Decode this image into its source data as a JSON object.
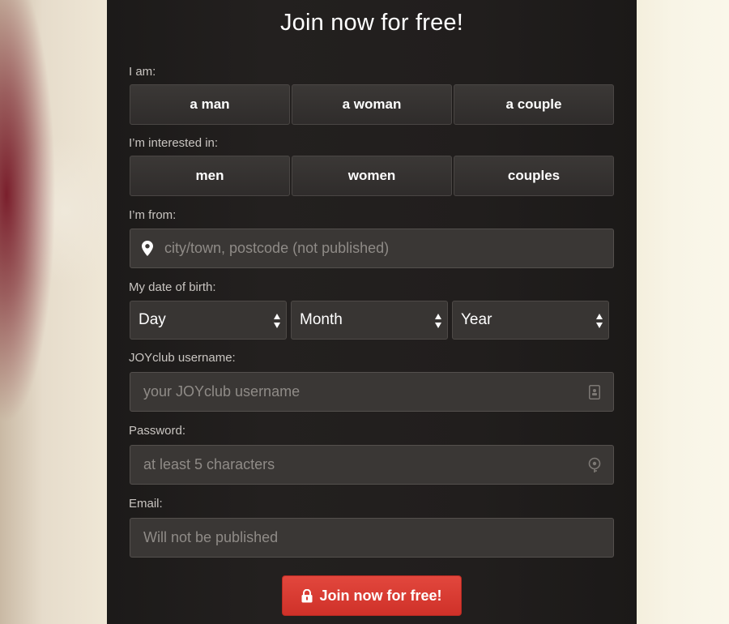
{
  "form": {
    "title": "Join now for free!",
    "gender": {
      "label": "I am:",
      "options": [
        "a man",
        "a woman",
        "a couple"
      ]
    },
    "interest": {
      "label": "I’m interested in:",
      "options": [
        "men",
        "women",
        "couples"
      ]
    },
    "location": {
      "label": "I’m from:",
      "placeholder": "city/town, postcode (not published)",
      "icon": "location-pin-icon"
    },
    "birth": {
      "label": "My date of birth:",
      "day": "Day",
      "month": "Month",
      "year": "Year"
    },
    "username": {
      "label": "JOYclub username:",
      "placeholder": "your JOYclub username",
      "icon": "contact-card-icon"
    },
    "password": {
      "label": "Password:",
      "placeholder": "at least 5 characters",
      "icon": "password-key-icon"
    },
    "email": {
      "label": "Email:",
      "placeholder": "Will not be published"
    },
    "submit": {
      "label": "Join now for free!",
      "icon": "lock-icon"
    }
  },
  "colors": {
    "panel": "#211e1d",
    "accent": "#d93a31",
    "text": "#ffffff",
    "label": "#c9c5c1",
    "placeholder": "#8f8b87"
  }
}
